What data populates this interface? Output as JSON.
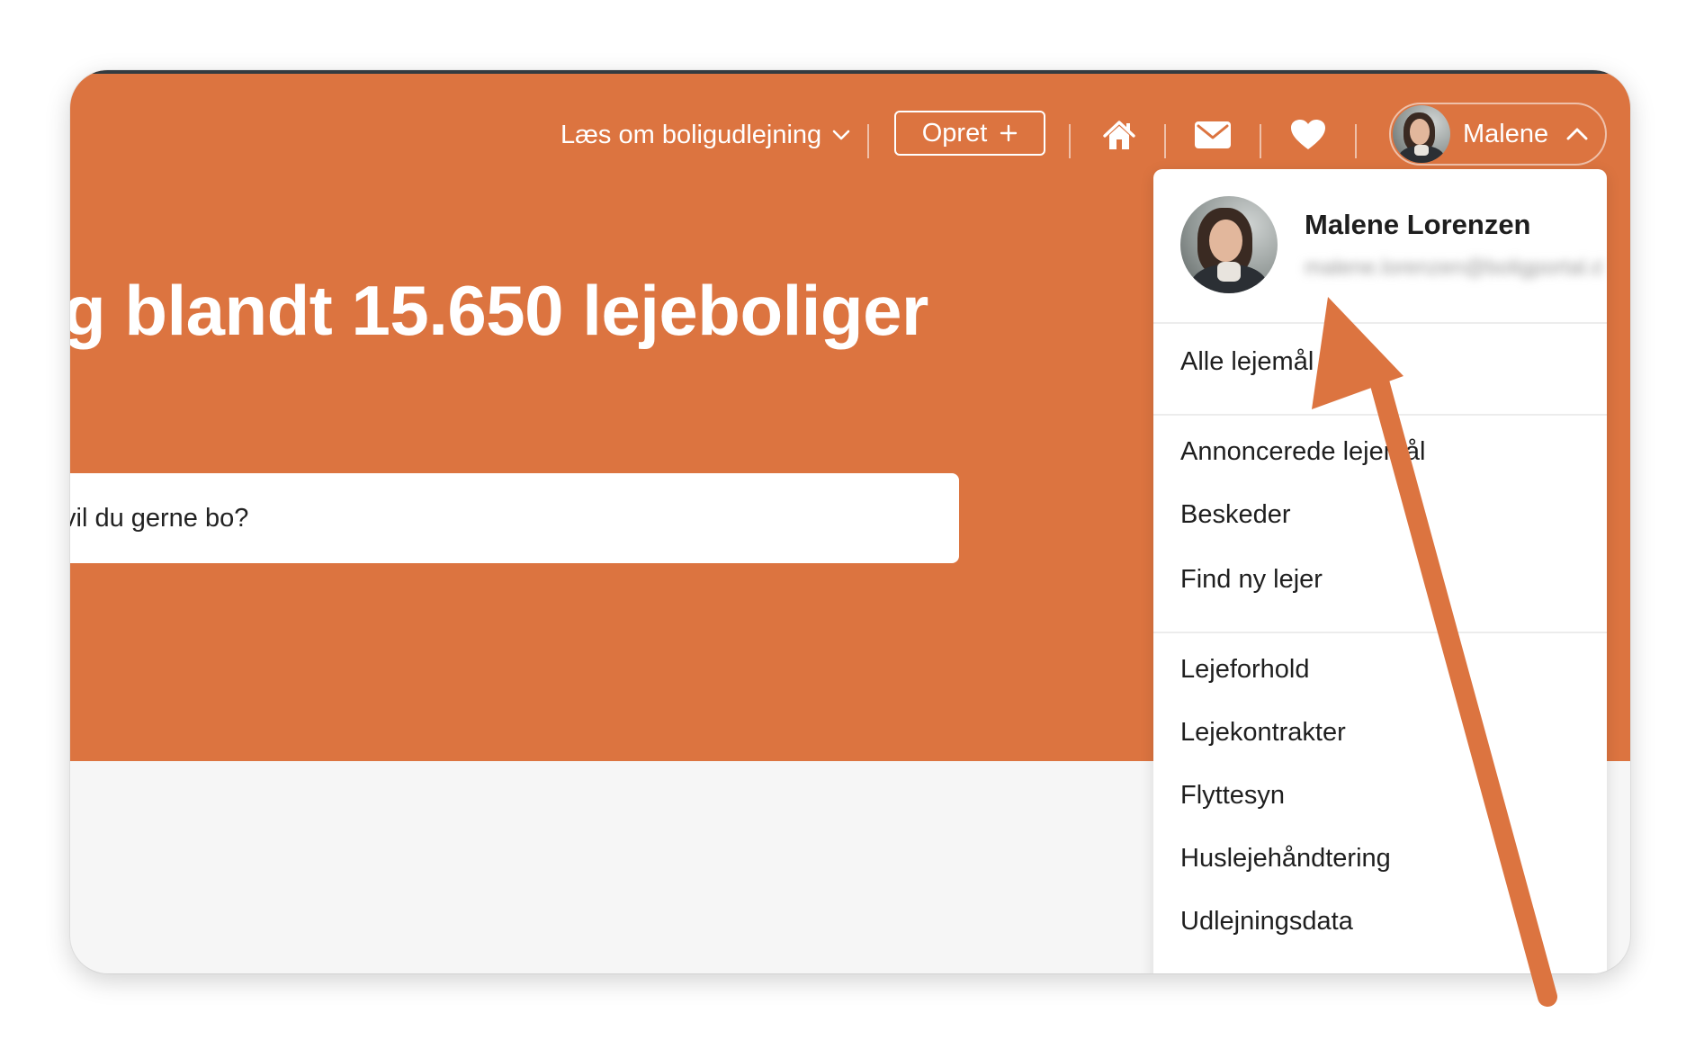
{
  "nav": {
    "read_more_label": "Læs om boligudlejning",
    "create_label": "Opret",
    "user_short_name": "Malene"
  },
  "hero": {
    "headline": "g blandt 15.650 lejeboliger",
    "search_placeholder": "vil du gerne bo?"
  },
  "account_menu": {
    "full_name": "Malene Lorenzen",
    "email_blurred": "malene.lorenzen@boligportal.dk",
    "sections": [
      [
        "Alle lejemål"
      ],
      [
        "Annoncerede lejemål",
        "Beskeder",
        "Find ny lejer"
      ],
      [
        "Lejeforhold",
        "Lejekontrakter",
        "Flyttesyn",
        "Huslejehåndtering",
        "Udlejningsdata"
      ]
    ]
  },
  "colors": {
    "brand_orange": "#dc7440",
    "page_gray": "#f6f6f6",
    "annotation_arrow": "#dc7440"
  },
  "icons": [
    "chevron-down-icon",
    "plus-icon",
    "home-icon",
    "mail-icon",
    "heart-icon",
    "chevron-up-icon",
    "annotation-arrow"
  ]
}
